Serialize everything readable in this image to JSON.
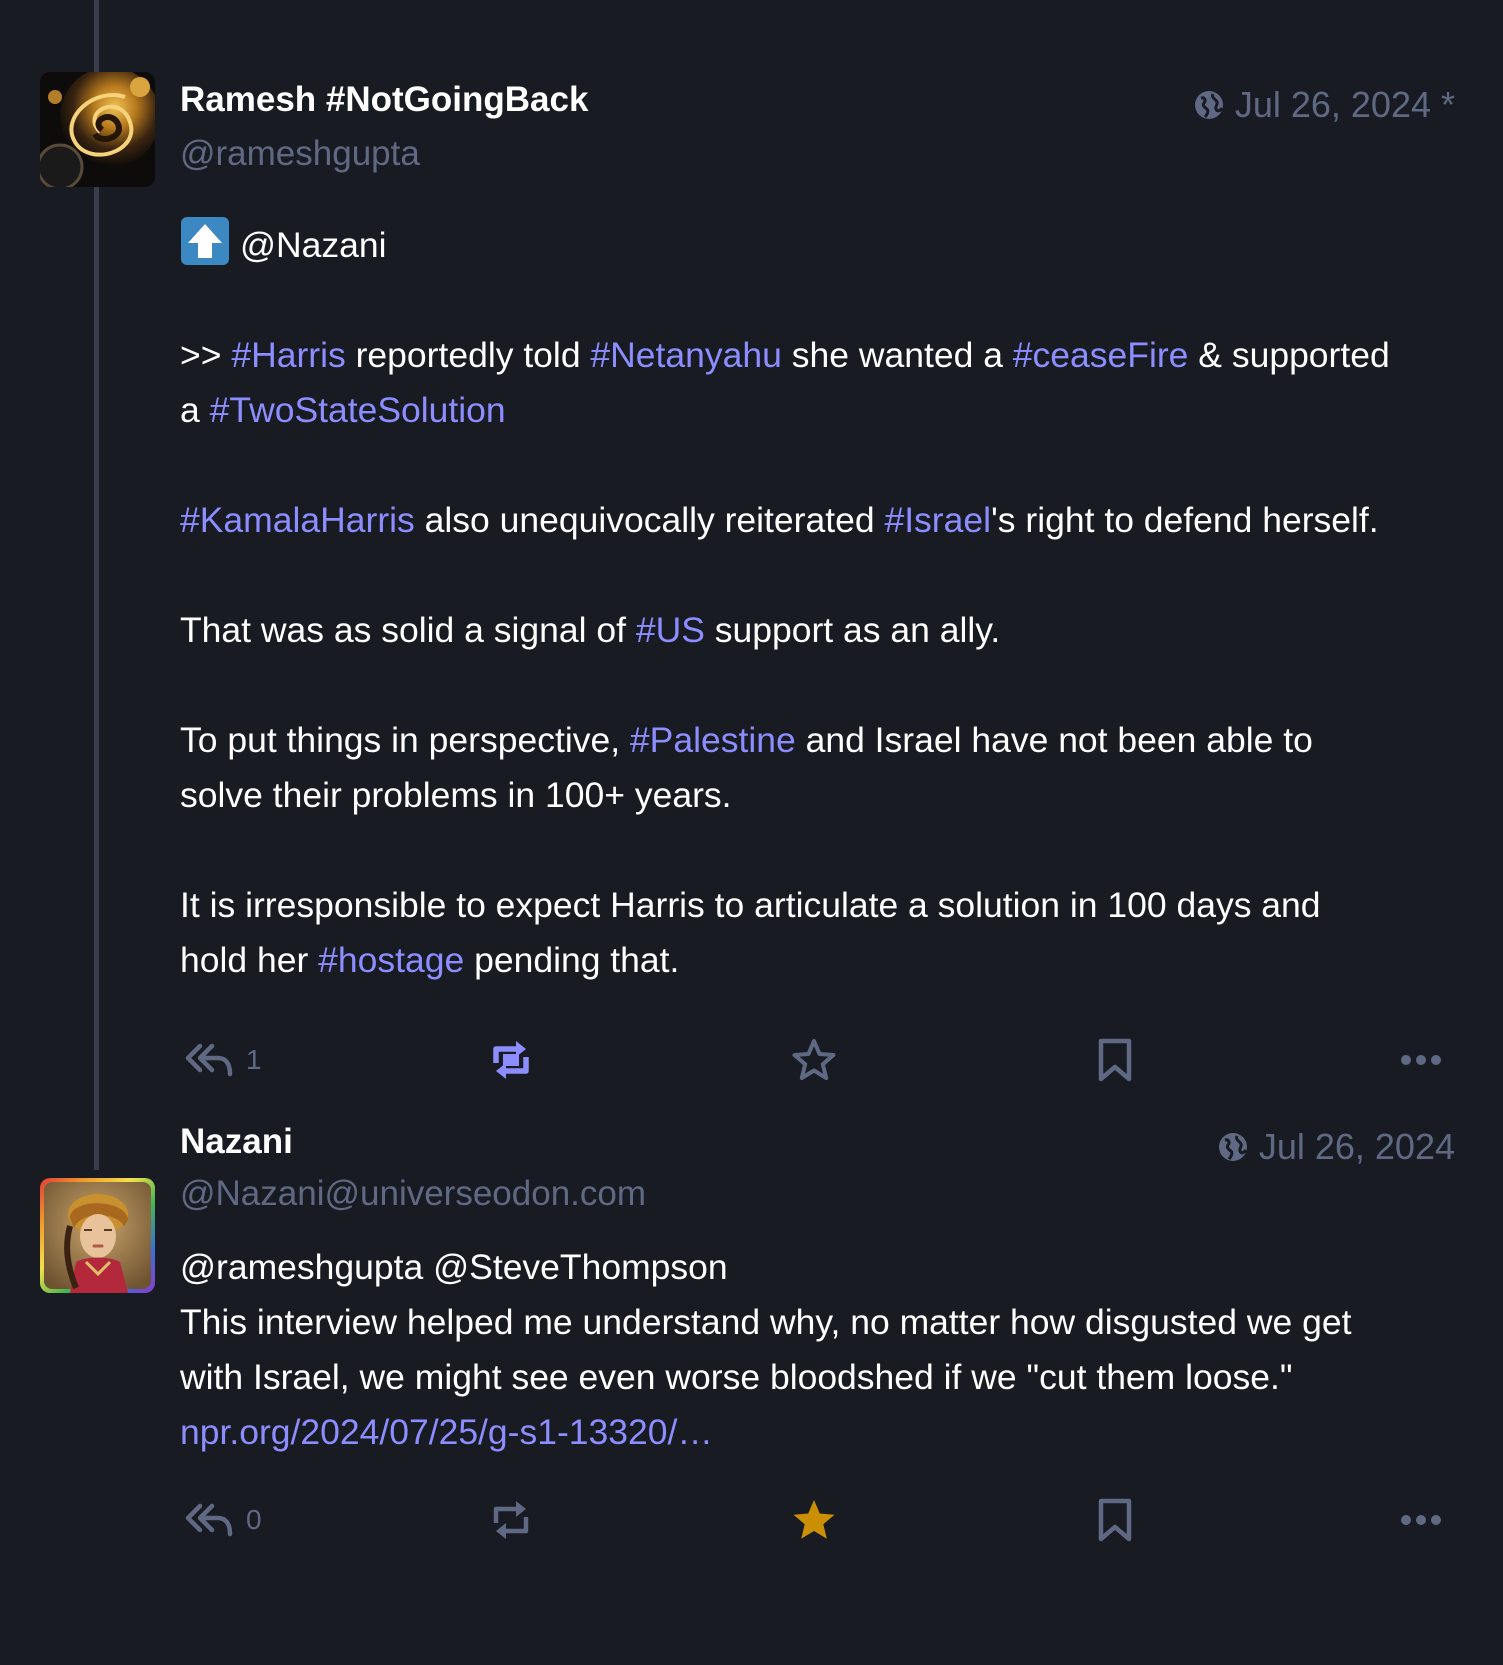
{
  "colors": {
    "background": "#191b22",
    "text": "#ffffff",
    "muted": "#606984",
    "accent": "#8c8dff",
    "boosted": "#8c8dff",
    "favourited": "#ca8f04",
    "thread_line": "#3a3d4c"
  },
  "posts": [
    {
      "display_name": "Ramesh #NotGoingBack",
      "handle": "@rameshgupta",
      "visibility_icon": "globe-icon",
      "date": "Jul 26, 2024",
      "edited_marker": "*",
      "avatar": "fractal-spiral-avatar",
      "badge_icon": "up-arrow-emoji-icon",
      "content": {
        "p1_mention": "@Nazani",
        "p2": {
          "prefix": ">> ",
          "tag1": "#Harris",
          "t1": " reportedly told ",
          "tag2": "#Netanyahu",
          "t2": " she wanted a ",
          "tag3": "#ceaseFire",
          "t3": " & supported",
          "t4": "a ",
          "tag4": "#TwoStateSolution"
        },
        "p3": {
          "tag1": "#KamalaHarris",
          "t1": " also unequivocally reiterated ",
          "tag2": "#Israel",
          "t2": "'s right to defend herself."
        },
        "p4": {
          "t1": "That was as solid a signal of ",
          "tag1": "#US",
          "t2": " support as an ally."
        },
        "p5": {
          "t1": "To put things in perspective, ",
          "tag1": "#Palestine",
          "t2": " and Israel have not been able to",
          "t3": "solve their problems in 100+ years."
        },
        "p6": {
          "t1": "It is irresponsible to expect Harris to articulate a solution in 100 days and",
          "t2": "hold her ",
          "tag1": "#hostage",
          "t3": " pending that."
        }
      },
      "actions": {
        "reply_count": "1",
        "boosted": true,
        "favourited": false
      }
    },
    {
      "display_name": "Nazani",
      "handle": "@Nazani@universeodon.com",
      "visibility_icon": "globe-icon",
      "date": "Jul 26, 2024",
      "avatar": "painted-portrait-avatar",
      "content": {
        "mentions": "@rameshgupta @SteveThompson",
        "line1": "This interview helped me understand why, no matter how  disgusted we get",
        "line2": "with Israel, we might see even worse bloodshed if we \"cut them loose.\"",
        "link": "npr.org/2024/07/25/g-s1-13320/…"
      },
      "actions": {
        "reply_count": "0",
        "boosted": false,
        "favourited": true
      }
    }
  ]
}
